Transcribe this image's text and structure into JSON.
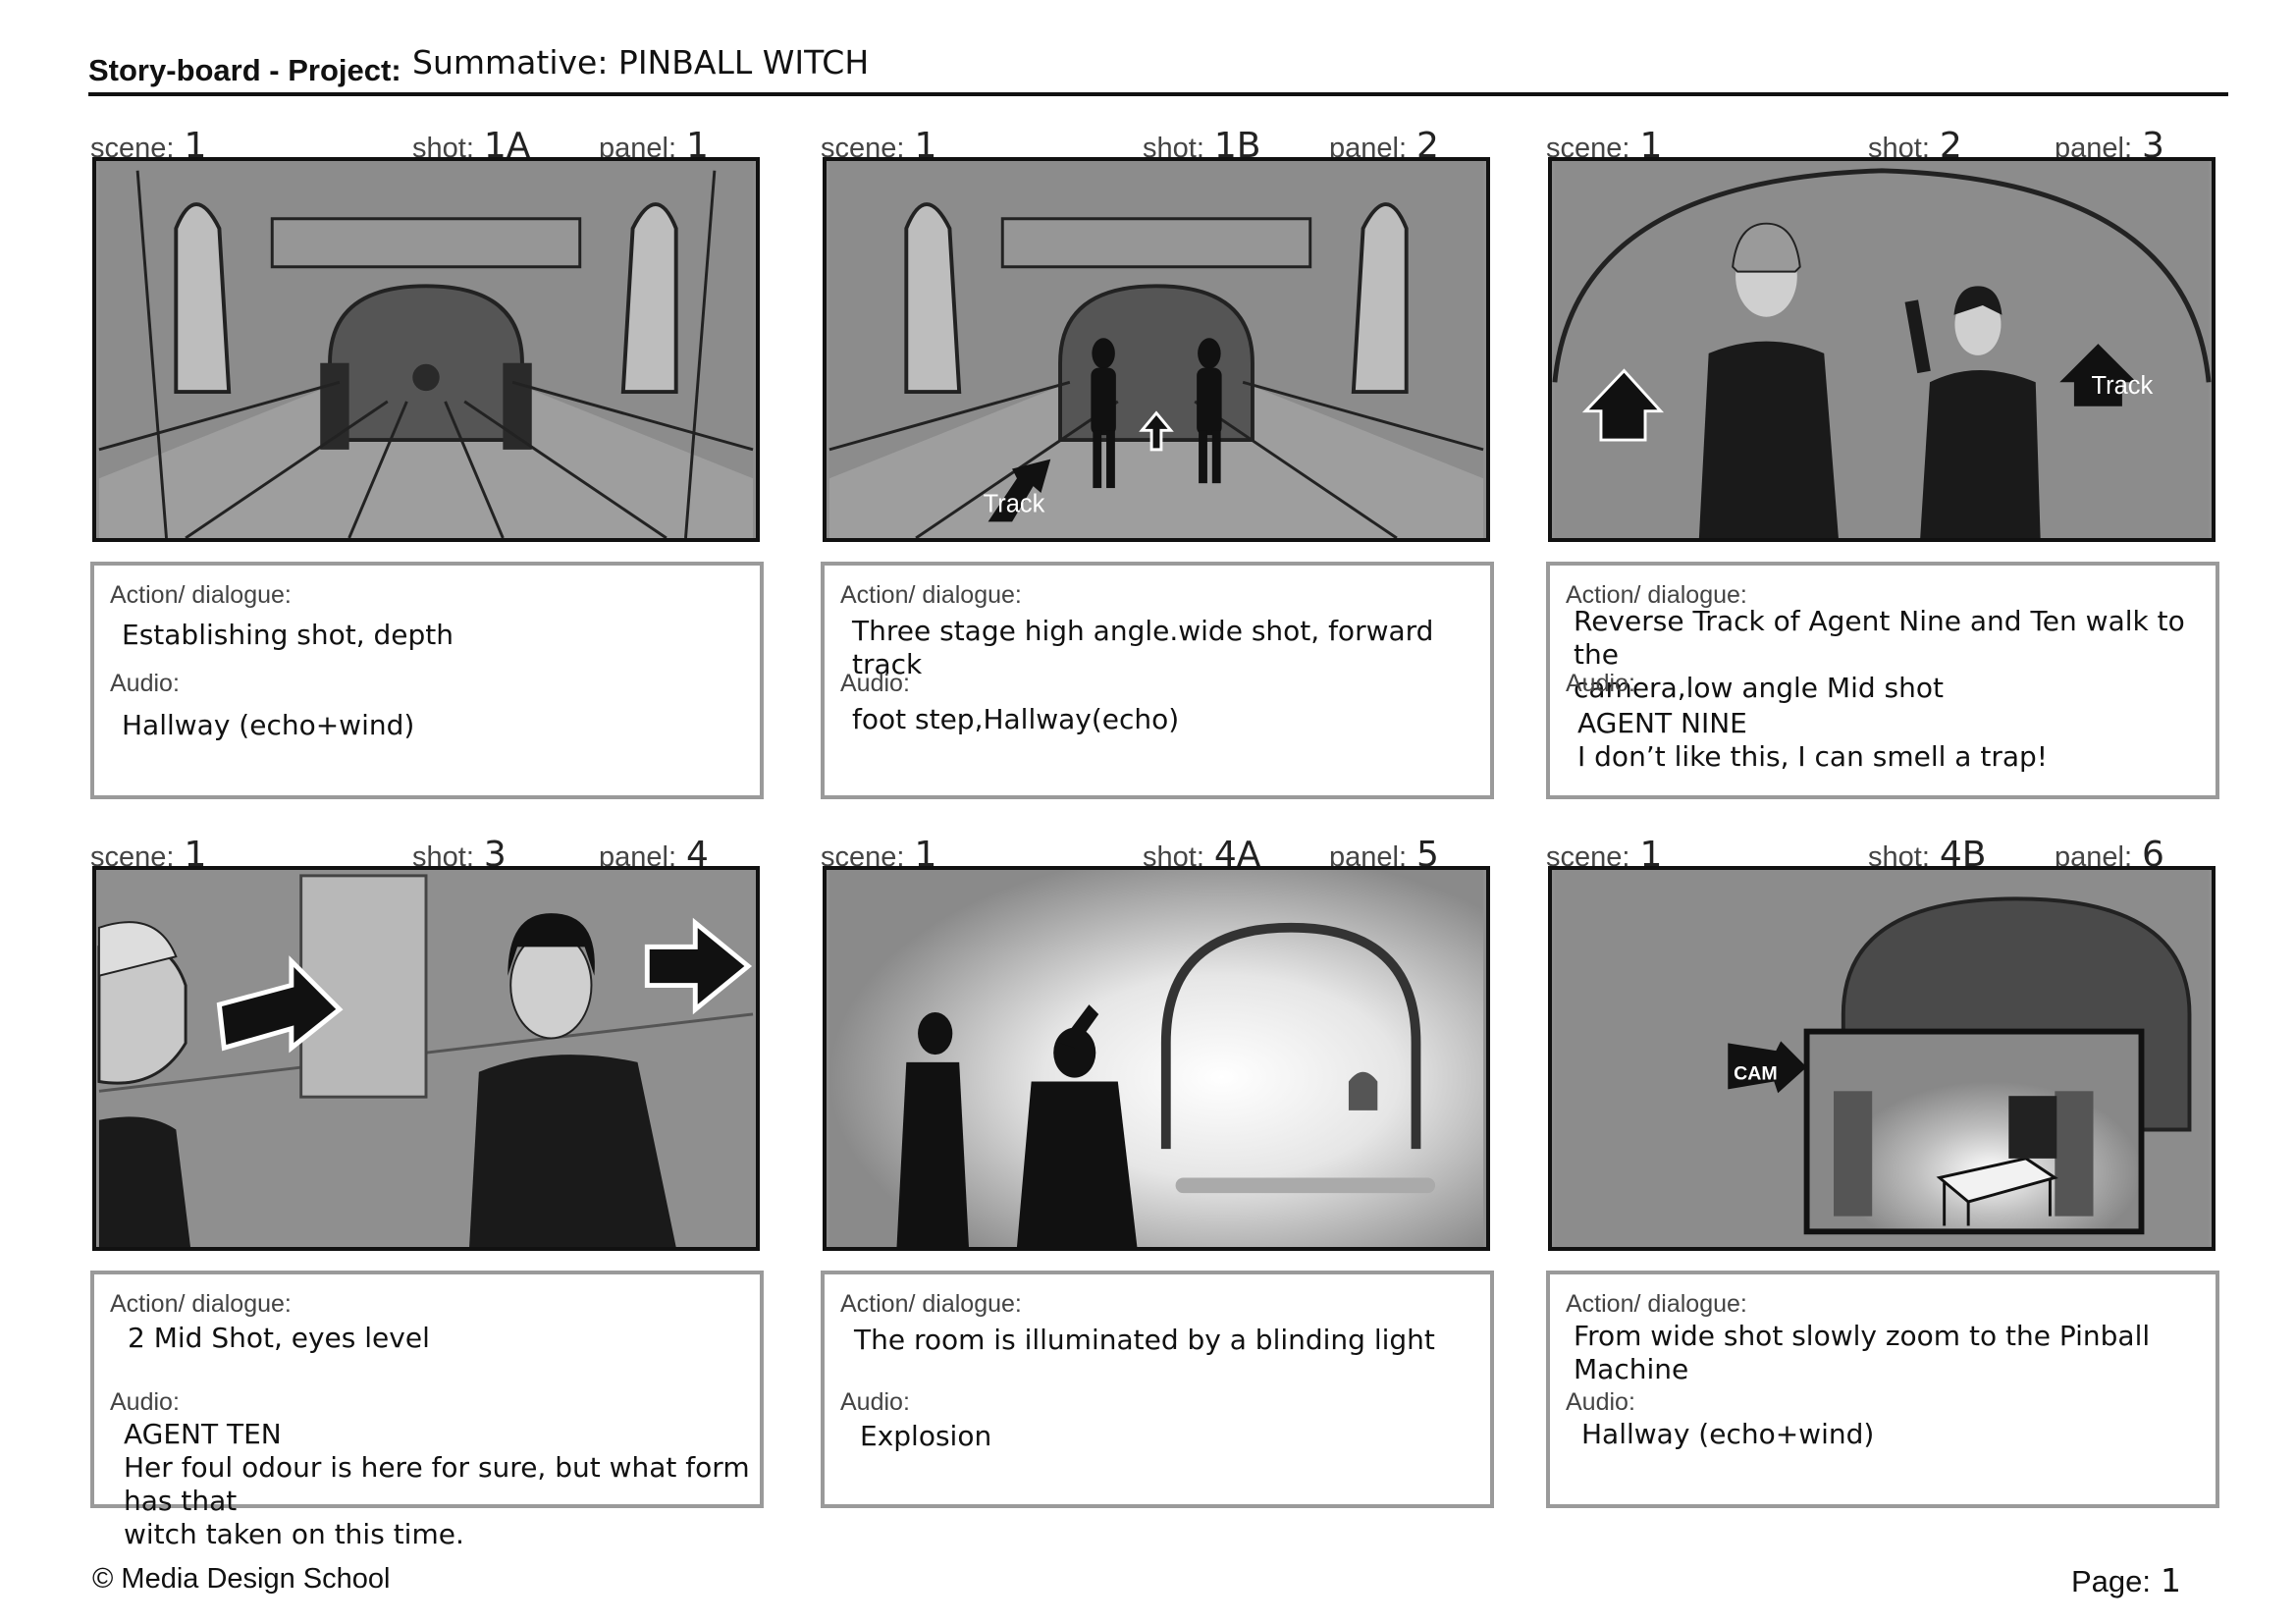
{
  "header": {
    "label": "Story-board - Project:",
    "project": "Summative: PINBALL WITCH"
  },
  "labels": {
    "scene": "scene:",
    "shot": "shot:",
    "panel": "panel:",
    "action": "Action/ dialogue:",
    "audio": "Audio:"
  },
  "panels": [
    {
      "scene": "1",
      "shot": "1A",
      "panel": "1",
      "action": "Establishing shot, depth",
      "audio": "Hallway (echo+wind)",
      "sketch_text": ""
    },
    {
      "scene": "1",
      "shot": "1B",
      "panel": "2",
      "action": "Three stage high angle.wide shot, forward track",
      "audio": "foot step,Hallway(echo)",
      "sketch_text": "Track"
    },
    {
      "scene": "1",
      "shot": "2",
      "panel": "3",
      "action": "Reverse Track of Agent Nine and Ten walk to the\ncamera,low angle Mid shot",
      "audio": "AGENT NINE\nI don’t like this, I can smell a trap!",
      "sketch_text": "Track"
    },
    {
      "scene": "1",
      "shot": "3",
      "panel": "4",
      "action": "2 Mid Shot, eyes level",
      "audio": "AGENT TEN\nHer foul odour is here for sure, but what form has that\nwitch taken on this time.",
      "sketch_text": ""
    },
    {
      "scene": "1",
      "shot": "4A",
      "panel": "5",
      "action": "The room is illuminated by a blinding light",
      "audio": "Explosion",
      "sketch_text": ""
    },
    {
      "scene": "1",
      "shot": "4B",
      "panel": "6",
      "action": "From wide shot slowly zoom to the Pinball\nMachine",
      "audio": "Hallway (echo+wind)",
      "sketch_text": "CAM"
    }
  ],
  "footer": {
    "copyright": "© Media Design School",
    "page_label": "Page:",
    "page_number": "1"
  }
}
